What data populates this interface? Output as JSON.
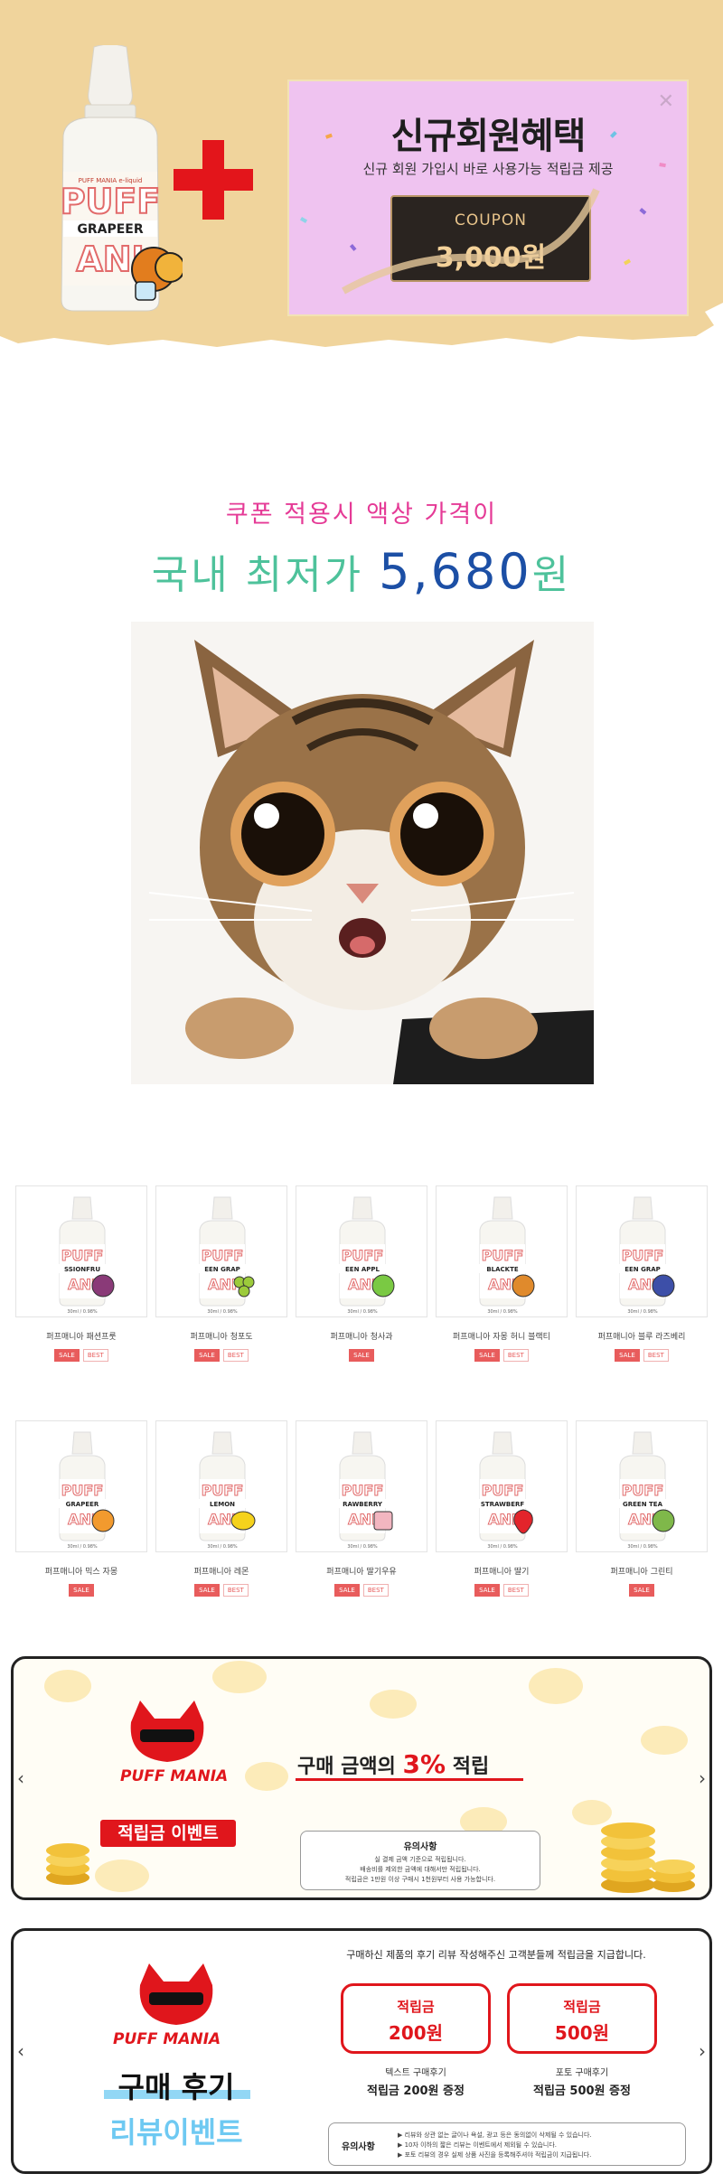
{
  "hero": {
    "bottle_brand": "PUFF MAN",
    "bottle_flavor": "GRAPEER",
    "coupon": {
      "title": "신규회원혜택",
      "subtitle": "신규 회원 가입시 바로 사용가능 적립금 제공",
      "label": "COUPON",
      "amount": "3,000원",
      "close_icon": "close-icon"
    },
    "colors": {
      "background": "#f0d49c",
      "card": "#efc3f0",
      "plus": "#e3151b"
    }
  },
  "price": {
    "line1": "쿠폰 적용시 액상 가격이",
    "line2_prefix": "국내 최저가",
    "value": "5,680",
    "unit": "원"
  },
  "products": {
    "row1": [
      {
        "name": "퍼프매니아 패션프룻",
        "flavor": "SSIONFRU",
        "volume": "30ml / 0.98%",
        "badges": [
          "SALE",
          "BEST"
        ],
        "fruit": "#8a3a78"
      },
      {
        "name": "퍼프매니아 청포도",
        "flavor": "EEN GRAP",
        "volume": "30ml / 0.98%",
        "badges": [
          "SALE",
          "BEST"
        ],
        "fruit": "#9ccb3b"
      },
      {
        "name": "퍼프매니아 청사과",
        "flavor": "EEN APPL",
        "volume": "30ml / 0.98%",
        "badges": [
          "SALE"
        ],
        "fruit": "#7ac943"
      },
      {
        "name": "퍼프매니아 자몽 허니 블랙티",
        "flavor": "BLACKTE",
        "volume": "30ml / 0.98%",
        "badges": [
          "SALE",
          "BEST"
        ],
        "fruit": "#e08a2c"
      },
      {
        "name": "퍼프매니아 블루 라즈베리",
        "flavor": "EEN GRAP",
        "volume": "30ml / 0.98%",
        "badges": [
          "SALE",
          "BEST"
        ],
        "fruit": "#3d4fa8"
      }
    ],
    "row2": [
      {
        "name": "퍼프매니아 믹스 자몽",
        "flavor": "GRAPEER",
        "volume": "30ml / 0.98%",
        "badges": [
          "SALE"
        ],
        "fruit": "#f29a2e"
      },
      {
        "name": "퍼프매니아 레몬",
        "flavor": "LEMON",
        "volume": "30ml / 0.98%",
        "badges": [
          "SALE",
          "BEST"
        ],
        "fruit": "#f5d21c"
      },
      {
        "name": "퍼프매니아 딸기우유",
        "flavor": "RAWBERRY",
        "volume": "30ml / 0.98%",
        "badges": [
          "SALE",
          "BEST"
        ],
        "fruit": "#f2b6c0"
      },
      {
        "name": "퍼프매니아 딸기",
        "flavor": "STRAWBERF",
        "volume": "30ml / 0.98%",
        "badges": [
          "SALE",
          "BEST"
        ],
        "fruit": "#e3242b"
      },
      {
        "name": "퍼프매니아 그린티",
        "flavor": "GREEN TEA",
        "volume": "30ml / 0.98%",
        "badges": [
          "SALE"
        ],
        "fruit": "#7fb84a"
      }
    ]
  },
  "event1": {
    "mascot": "PUFF MANIA",
    "pill": "적립금 이벤트",
    "headline_prefix": "구매 금액의",
    "headline_percent": "3%",
    "headline_suffix": "적립",
    "notice_title": "유의사항",
    "notice_lines": [
      "실 결제 금액 기준으로 적립됩니다.",
      "배송비를 제외한 금액에 대해서만 적립됩니다.",
      "적립금은 1만원 이상 구매시 1천원부터 사용 가능합니다."
    ],
    "arrow_left": "‹",
    "arrow_right": "›"
  },
  "event2": {
    "mascot": "PUFF MANIA",
    "top_text": "구매하신 제품의 후기 리뷰 작성해주신 고객분들께 적립금을 지급합니다.",
    "title_line1": "구매 후기",
    "title_line2": "리뷰이벤트",
    "rewards": [
      {
        "name": "적립금",
        "amount": "200원",
        "type": "텍스트 구매후기",
        "desc": "적립금 200원 증정"
      },
      {
        "name": "적립금",
        "amount": "500원",
        "type": "포토 구매후기",
        "desc": "적립금 500원 증정"
      }
    ],
    "notice_title": "유의사항",
    "notice_lines": [
      "▶ 리뷰와 상관 없는 글이나 욕설, 광고 등은 동의없이 삭제될 수 있습니다.",
      "▶ 10자 이하의 짧은 리뷰는 이벤트에서 제외될 수 있습니다.",
      "▶ 포토 리뷰의 경우 실제 상품 사진을 등록해주셔야 적립금이 지급됩니다."
    ],
    "arrow_left": "‹",
    "arrow_right": "›"
  }
}
